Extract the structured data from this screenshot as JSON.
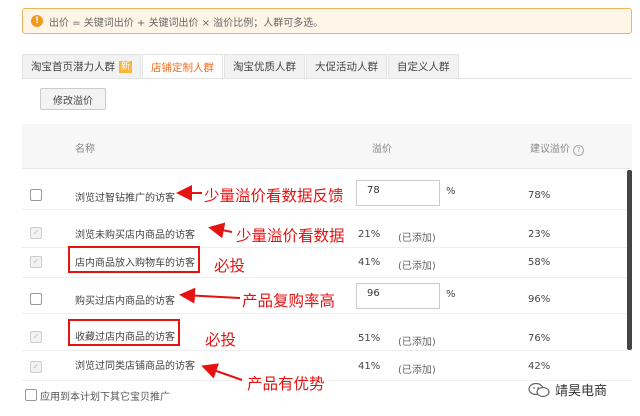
{
  "notice": {
    "text": "出价 = 关键词出价 + 关键词出价 × 溢价比例；人群可多选。"
  },
  "tabs": [
    {
      "label": "淘宝首页潜力人群",
      "badge": "新"
    },
    {
      "label": "店铺定制人群",
      "active": true
    },
    {
      "label": "淘宝优质人群"
    },
    {
      "label": "大促活动人群"
    },
    {
      "label": "自定义人群"
    }
  ],
  "toolbar": {
    "edit_label": "修改溢价"
  },
  "table": {
    "headers": {
      "name": "名称",
      "premium": "溢价",
      "suggest": "建议溢价"
    },
    "rows": [
      {
        "name": "浏览过智钻推广的访客",
        "premium": "78",
        "unit": "%",
        "suggest": "78%",
        "editable": true
      },
      {
        "name": "浏览未购买店内商品的访客",
        "premium": "21%",
        "added": "(已添加)",
        "suggest": "23%"
      },
      {
        "name": "店内商品放入购物车的访客",
        "premium": "41%",
        "added": "(已添加)",
        "suggest": "58%"
      },
      {
        "name": "购买过店内商品的访客",
        "premium": "96",
        "unit": "%",
        "suggest": "96%",
        "editable": true
      },
      {
        "name": "收藏过店内商品的访客",
        "premium": "51%",
        "added": "(已添加)",
        "suggest": "76%"
      },
      {
        "name": "浏览过同类店铺商品的访客",
        "premium": "41%",
        "added": "(已添加)",
        "suggest": "42%"
      }
    ]
  },
  "annotations": [
    "少量溢价看数据反馈",
    "少量溢价看数据",
    "必投",
    "产品复购率高",
    "必投",
    "产品有优势"
  ],
  "footer": {
    "apply_label": "应用到本计划下其它宝贝推广"
  },
  "watermark": {
    "text": "靖昊电商"
  },
  "colors": {
    "accent": "#f26b1d",
    "annotation": "#e51212",
    "notice_bg": "#fff5e6"
  }
}
